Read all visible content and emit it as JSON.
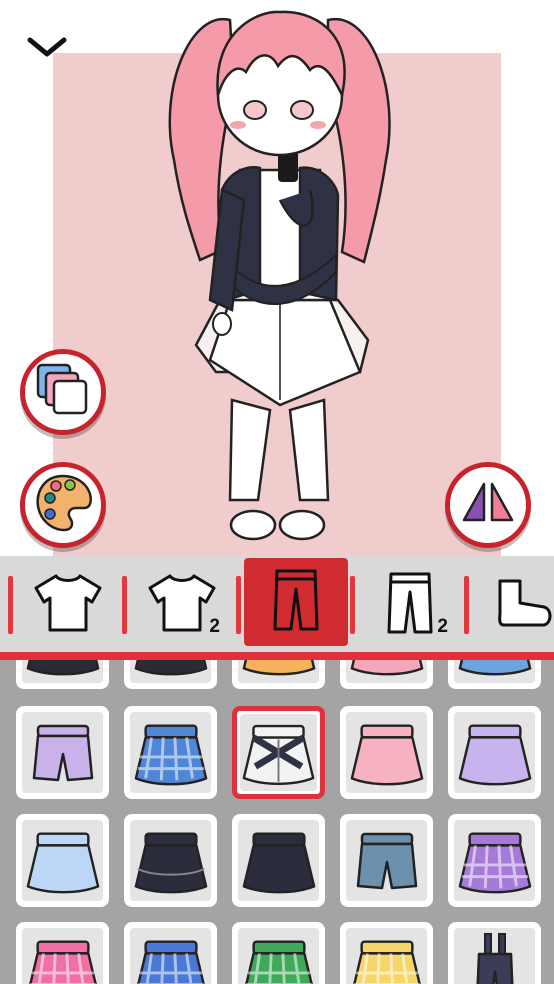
{
  "toolbar": {
    "collapse_icon": "chevron-down-icon"
  },
  "colors": {
    "accent": "#cf2b30",
    "backdrop": "#f0cccc",
    "grid_bg": "#a4a4a4",
    "tabbar_bg": "#d9d9d9"
  },
  "side_buttons": [
    {
      "name": "layers-button",
      "icon": "layers-icon"
    },
    {
      "name": "palette-button",
      "icon": "palette-icon"
    },
    {
      "name": "flip-button",
      "icon": "flip-icon"
    }
  ],
  "tabs": [
    {
      "name": "tab-top",
      "icon": "shirt-icon",
      "badge": "",
      "active": false
    },
    {
      "name": "tab-top-2",
      "icon": "shirt-icon",
      "badge": "2",
      "active": false
    },
    {
      "name": "tab-bottom",
      "icon": "pants-icon",
      "badge": "",
      "active": true
    },
    {
      "name": "tab-bottom-2",
      "icon": "pants-icon",
      "badge": "2",
      "active": false
    },
    {
      "name": "tab-socks",
      "icon": "sock-icon",
      "badge": "",
      "active": false
    }
  ],
  "items": [
    {
      "kind": "skirt",
      "color": "#2b2b36"
    },
    {
      "kind": "skirt",
      "color": "#2b2b36"
    },
    {
      "kind": "skirt",
      "color": "#f6b25a"
    },
    {
      "kind": "skirt",
      "color": "#f4a7b9"
    },
    {
      "kind": "skirt",
      "color": "#6fa3e0"
    },
    {
      "kind": "shorts",
      "color": "#c9b2ea"
    },
    {
      "kind": "plaid-skirt",
      "color": "#4f86d8"
    },
    {
      "kind": "harness-skirt",
      "color": "#f2f2f2",
      "selected": true
    },
    {
      "kind": "skirt",
      "color": "#f6b2c0"
    },
    {
      "kind": "skirt",
      "color": "#c7b3ee"
    },
    {
      "kind": "skirt",
      "color": "#bcd6f5"
    },
    {
      "kind": "tier-skirt",
      "color": "#2b2d3d"
    },
    {
      "kind": "skirt",
      "color": "#2b2d3d"
    },
    {
      "kind": "shorts",
      "color": "#6d90ad"
    },
    {
      "kind": "plaid-skirt",
      "color": "#a67ad9"
    },
    {
      "kind": "plaid-skirt",
      "color": "#f06fa5"
    },
    {
      "kind": "plaid-skirt",
      "color": "#4a78d6"
    },
    {
      "kind": "plaid-skirt",
      "color": "#3fa85a"
    },
    {
      "kind": "plaid-skirt",
      "color": "#f6d56a"
    },
    {
      "kind": "overalls",
      "color": "#3a3d55"
    }
  ]
}
